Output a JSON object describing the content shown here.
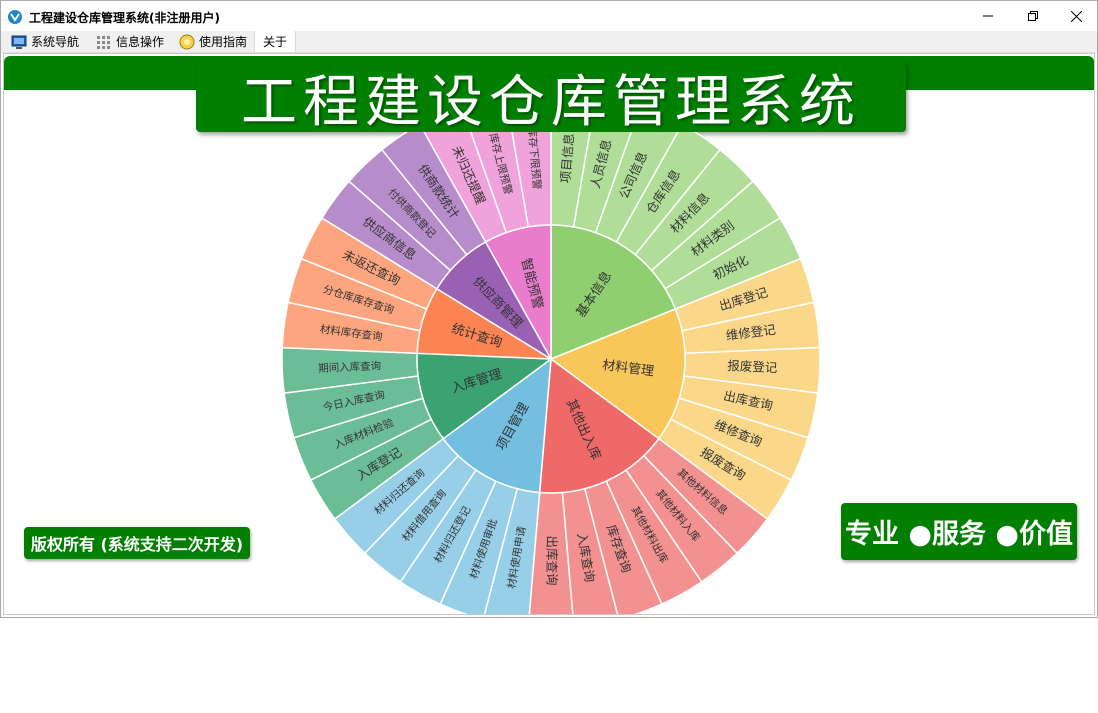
{
  "window": {
    "title": "工程建设仓库管理系统(非注册用户)",
    "controls": [
      "minimize",
      "restore",
      "close"
    ]
  },
  "menu": [
    {
      "label": "系统导航",
      "icon": "monitor-icon"
    },
    {
      "label": "信息操作",
      "icon": "grid-icon"
    },
    {
      "label": "使用指南",
      "icon": "help-bulb-icon"
    },
    {
      "label": "关于",
      "icon": ""
    }
  ],
  "banner": {
    "title": "工程建设仓库管理系统"
  },
  "copyright": "版权所有 (系统支持二次开发)",
  "slogan": "专业 ●服务 ●价值",
  "sunburst": {
    "categories": [
      {
        "label": "基本信息",
        "color": "#8fcf70",
        "children": [
          {
            "label": "项目信息",
            "color": "#b0dd98"
          },
          {
            "label": "人员信息",
            "color": "#b0dd98"
          },
          {
            "label": "公司信息",
            "color": "#b0dd98"
          },
          {
            "label": "仓库信息",
            "color": "#b0dd98"
          },
          {
            "label": "材料信息",
            "color": "#b0dd98"
          },
          {
            "label": "材料类别",
            "color": "#b0dd98"
          },
          {
            "label": "初始化",
            "color": "#b0dd98"
          }
        ]
      },
      {
        "label": "材料管理",
        "color": "#f9c759",
        "children": [
          {
            "label": "出库登记",
            "color": "#fbd78a"
          },
          {
            "label": "维修登记",
            "color": "#fbd78a"
          },
          {
            "label": "报废登记",
            "color": "#fbd78a"
          },
          {
            "label": "出库查询",
            "color": "#fbd78a"
          },
          {
            "label": "维修查询",
            "color": "#fbd78a"
          },
          {
            "label": "报废查询",
            "color": "#fbd78a"
          }
        ]
      },
      {
        "label": "其他出入库",
        "color": "#ef6969",
        "children": [
          {
            "label": "其他材料信息",
            "color": "#f39090"
          },
          {
            "label": "其他材料入库",
            "color": "#f39090"
          },
          {
            "label": "其他材料出库",
            "color": "#f39090"
          },
          {
            "label": "库存查询",
            "color": "#f39090"
          },
          {
            "label": "入库查询",
            "color": "#f39090"
          },
          {
            "label": "出库查询",
            "color": "#f39090"
          }
        ]
      },
      {
        "label": "项目管理",
        "color": "#74bedf",
        "children": [
          {
            "label": "材料使用申请",
            "color": "#97cfe8"
          },
          {
            "label": "材料使用审批",
            "color": "#97cfe8"
          },
          {
            "label": "材料归还登记",
            "color": "#97cfe8"
          },
          {
            "label": "材料借用查询",
            "color": "#97cfe8"
          },
          {
            "label": "材料归还查询",
            "color": "#97cfe8"
          }
        ]
      },
      {
        "label": "入库管理",
        "color": "#3ba272",
        "children": [
          {
            "label": "入库登记",
            "color": "#6bbd96"
          },
          {
            "label": "入库材料检验",
            "color": "#6bbd96"
          },
          {
            "label": "今日入库查询",
            "color": "#6bbd96"
          },
          {
            "label": "期间入库查询",
            "color": "#6bbd96"
          }
        ]
      },
      {
        "label": "统计查询",
        "color": "#fc8452",
        "children": [
          {
            "label": "材料库存查询",
            "color": "#fda57f"
          },
          {
            "label": "分仓库库存查询",
            "color": "#fda57f"
          },
          {
            "label": "未返还查询",
            "color": "#fda57f"
          }
        ]
      },
      {
        "label": "供应商管理",
        "color": "#9a60b4",
        "children": [
          {
            "label": "供应商信息",
            "color": "#b68cca"
          },
          {
            "label": "付供商款登记",
            "color": "#b68cca"
          },
          {
            "label": "供商款统计",
            "color": "#b68cca"
          }
        ]
      },
      {
        "label": "智能预警",
        "color": "#ea7ccc",
        "children": [
          {
            "label": "未归还提醒",
            "color": "#f0a2db"
          },
          {
            "label": "库存上限预警",
            "color": "#f0a2db"
          },
          {
            "label": "库存下限预警",
            "color": "#f0a2db"
          }
        ]
      }
    ]
  }
}
